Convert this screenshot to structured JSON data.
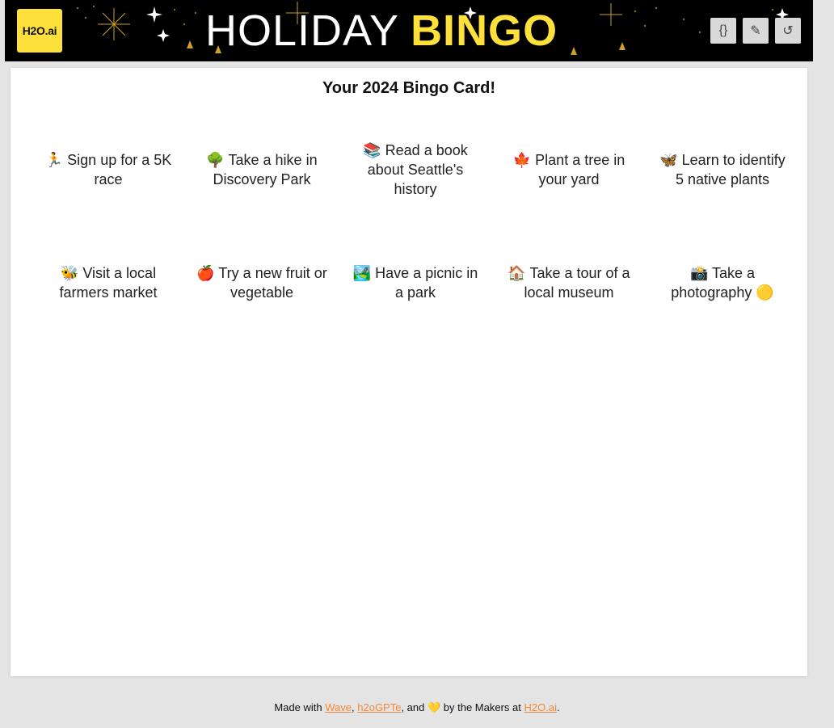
{
  "header": {
    "logo_text": "H2O.ai",
    "title_part1": "HOLIDAY",
    "title_part2": "BINGO",
    "buttons": [
      {
        "icon": "code-braces-icon",
        "glyph": "{}"
      },
      {
        "icon": "pencil-icon",
        "glyph": "✎"
      },
      {
        "icon": "undo-icon",
        "glyph": "↺"
      }
    ]
  },
  "card": {
    "title": "Your 2024 Bingo Card!",
    "cells": [
      {
        "label": "🏃 Sign up for a 5K race"
      },
      {
        "label": "🌳 Take a hike in Discovery Park"
      },
      {
        "label": "📚 Read a book about Seattle's history"
      },
      {
        "label": "🍁 Plant a tree in your yard"
      },
      {
        "label": "🦋 Learn to identify 5 native plants"
      },
      {
        "label": "🐝 Visit a local farmers market"
      },
      {
        "label": "🍎 Try a new fruit or vegetable"
      },
      {
        "label": "🏞️ Have a picnic in a park"
      },
      {
        "label": "🏠 Take a tour of a local museum"
      },
      {
        "label": "📸 Take a photography 🟡"
      }
    ]
  },
  "footer": {
    "prefix": "Made with ",
    "link1": "Wave",
    "sep1": ", ",
    "link2": "h2oGPTe",
    "sep2": ", and 💛 by the Makers at ",
    "link3": "H2O.ai",
    "suffix": "."
  },
  "colors": {
    "brand_yellow": "#fde13a",
    "header_bg": "#000000",
    "link_orange": "#ef8a3c",
    "page_bg": "#e4e4e4"
  }
}
